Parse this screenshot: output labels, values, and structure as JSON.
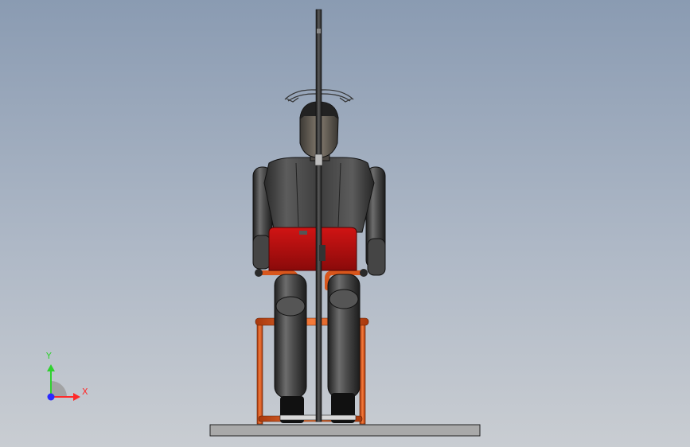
{
  "viewport": {
    "background_top": "#8a9bb2",
    "background_bottom": "#c9cdd2"
  },
  "triad": {
    "x_label": "X",
    "y_label": "Y",
    "x_color": "#ff2a2a",
    "y_color": "#2fd12f",
    "z_color": "#2a2aff"
  },
  "model": {
    "body_color": "#3a3a3a",
    "seat_color": "#b80f0f",
    "frame_color": "#e0581c",
    "pole_color": "#2b2b2b",
    "base_color": "#a9a9a9"
  }
}
